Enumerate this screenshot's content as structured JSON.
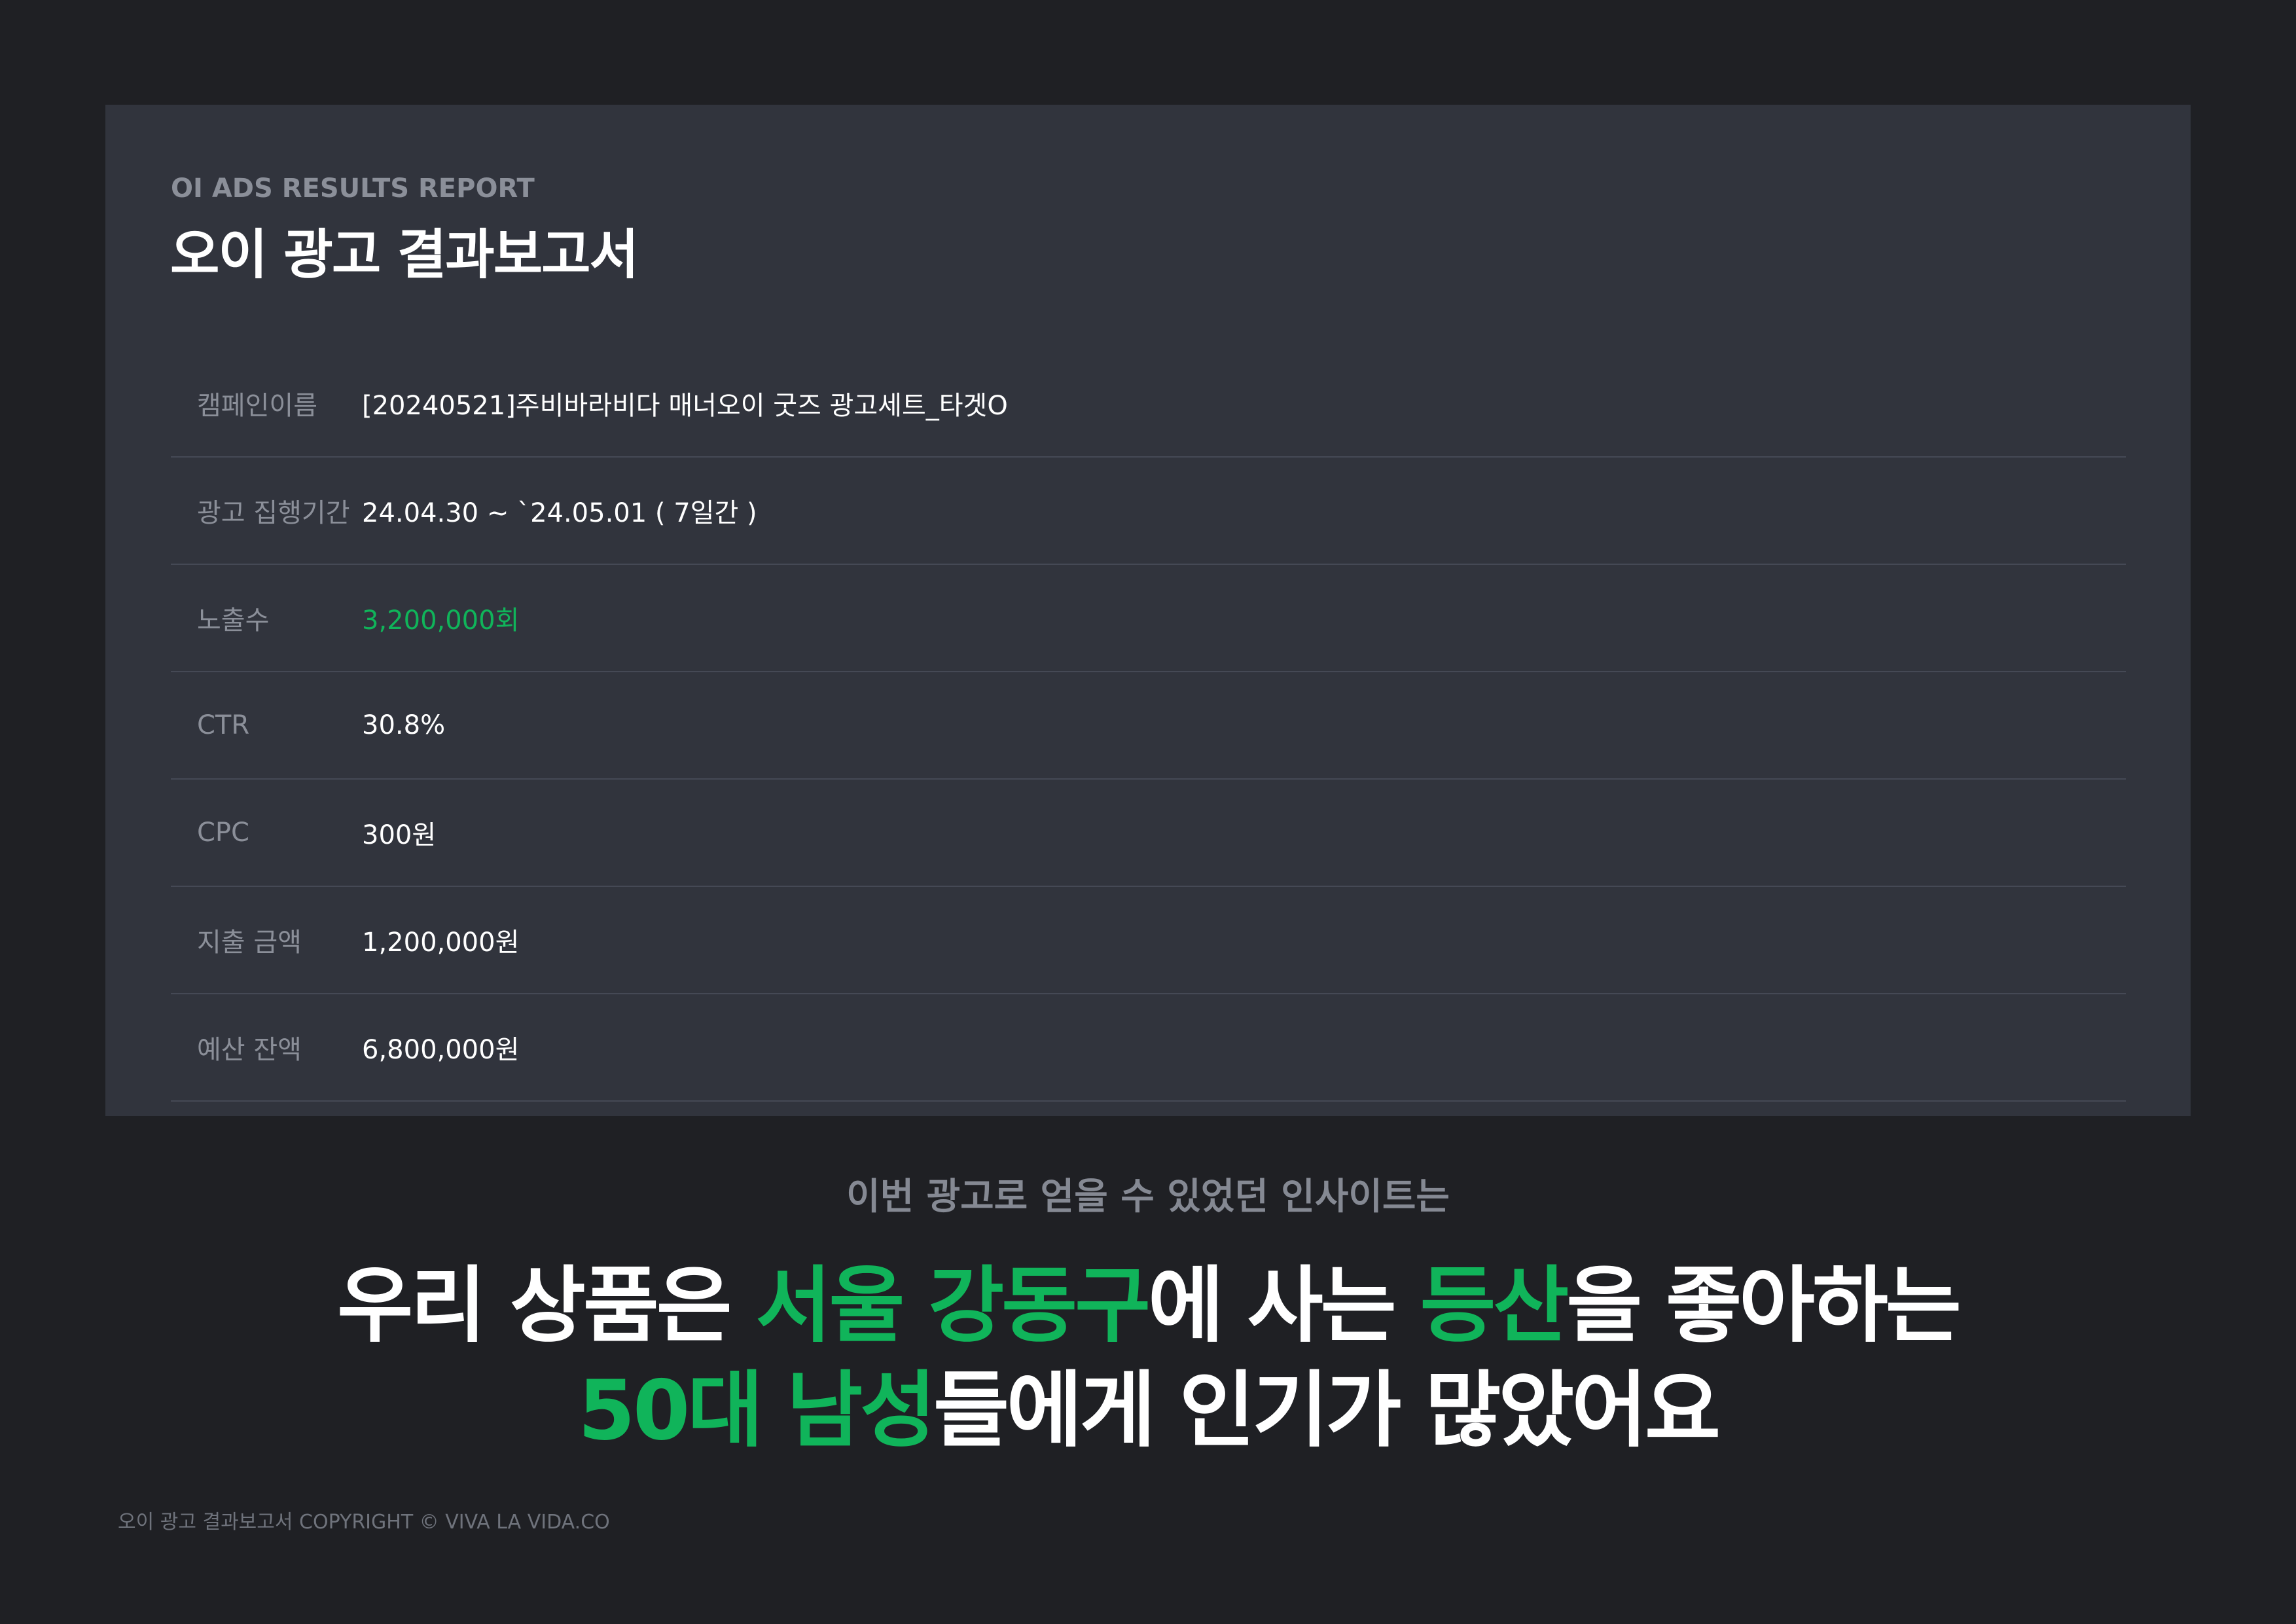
{
  "report": {
    "eyebrow": "OI ADS RESULTS REPORT",
    "title": "오이 광고 결과보고서",
    "rows": [
      {
        "label": "캠페인이름",
        "value": "[20240521]주비바라비다 매너오이 굿즈 광고세트_타겟O"
      },
      {
        "label": "광고 집행기간",
        "value": "24.04.30 ~ `24.05.01  ( 7일간 )"
      },
      {
        "label": "노출수",
        "value": "3,200,000회"
      },
      {
        "label": "CTR",
        "value": "30.8%"
      },
      {
        "label": "CPC",
        "value": "300원"
      },
      {
        "label": "지출 금액",
        "value": "1,200,000원"
      },
      {
        "label": "예산 잔액",
        "value": "6,800,000원"
      }
    ]
  },
  "insight": {
    "intro": "이번 광고로 얻을 수 있었던 인사이트는",
    "line1": {
      "t1": "우리 상품은 ",
      "h1": "서울 강동구",
      "t2": "에 사는 ",
      "h2": "등산",
      "t3": "을 좋아하는"
    },
    "line2": {
      "h1": "50대 남성",
      "t1": "들에게 인기가 많았어요"
    }
  },
  "footer": {
    "text": "오이 광고 결과보고서  COPYRIGHT © VIVA LA VIDA.CO"
  },
  "colors": {
    "background": "#1f2024",
    "card": "#31343d",
    "accent": "#10b45a",
    "label": "#8b8f99"
  }
}
